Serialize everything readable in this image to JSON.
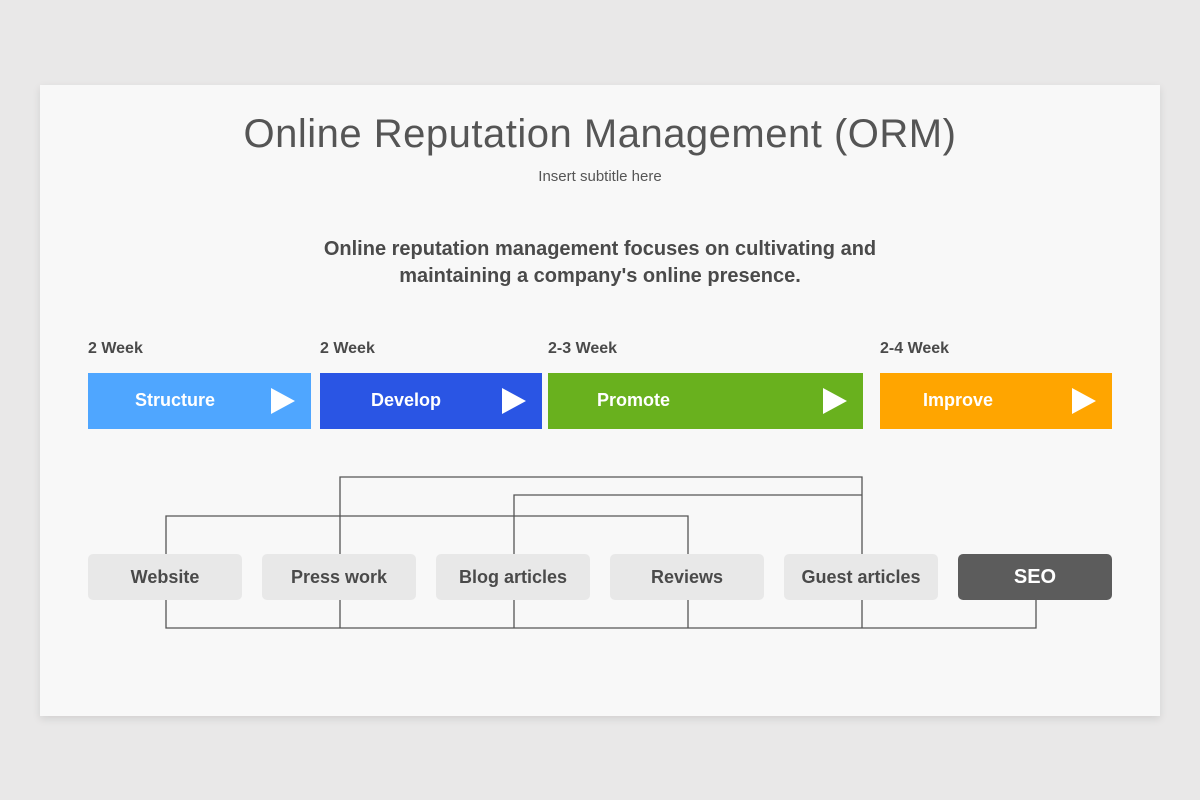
{
  "title": "Online Reputation Management (ORM)",
  "subtitle": "Insert subtitle here",
  "lead": "Online reputation management focuses on cultivating and maintaining a company's online presence.",
  "phases": [
    {
      "duration": "2 Week",
      "label": "Structure",
      "color": "#4fa6ff"
    },
    {
      "duration": "2 Week",
      "label": "Develop",
      "color": "#2a55e4"
    },
    {
      "duration": "2-3 Week",
      "label": "Promote",
      "color": "#69b11e"
    },
    {
      "duration": "2-4 Week",
      "label": "Improve",
      "color": "#ffa500"
    }
  ],
  "items": [
    {
      "label": "Website"
    },
    {
      "label": "Press work"
    },
    {
      "label": "Blog articles"
    },
    {
      "label": "Reviews"
    },
    {
      "label": "Guest articles"
    },
    {
      "label": "SEO"
    }
  ],
  "colors": {
    "connector": "#555555",
    "item_bg": "#e8e8e8",
    "seo_bg": "#5c5c5c"
  }
}
